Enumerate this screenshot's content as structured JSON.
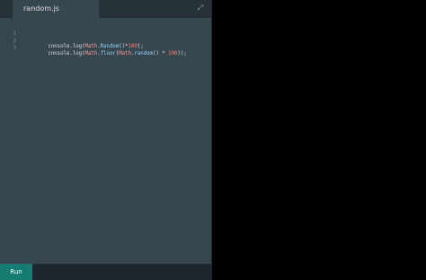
{
  "editor": {
    "tab_label": "random.js",
    "expand_icon": "expand-icon",
    "lines": [
      {
        "number": "1",
        "code": "console.log(Math.Random()*100);"
      },
      {
        "number": "2",
        "code": "console.log(Math.floor(Math.random() * 100));"
      },
      {
        "number": "3",
        "code": ""
      }
    ]
  },
  "footer": {
    "run_label": "Run"
  },
  "colors": {
    "editor_background": "#37474f",
    "tabbar_background": "#263238",
    "run_button": "#167c73",
    "right_panel": "#000000"
  }
}
